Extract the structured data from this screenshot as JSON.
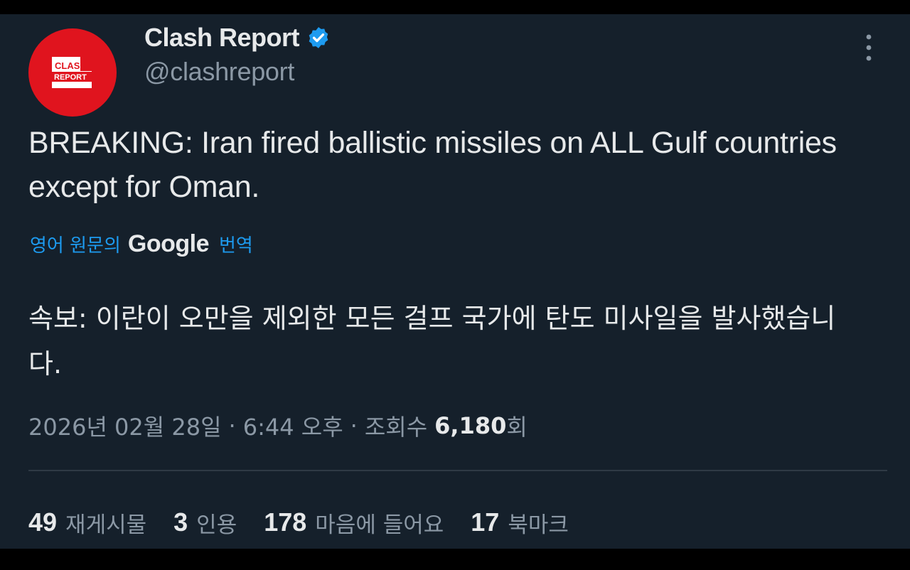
{
  "colors": {
    "background": "#15202b",
    "text_primary": "#e7e9ea",
    "text_secondary": "#8b98a5",
    "link": "#1d9bf0",
    "verified": "#1d9bf0",
    "avatar_red": "#e0141e"
  },
  "author": {
    "avatar_logo_line1": "CLASH",
    "avatar_logo_line2": "REPORT",
    "display_name": "Clash Report",
    "verified_icon": "verified-badge-icon",
    "handle": "@clashreport"
  },
  "menu": {
    "icon": "more-vertical-icon"
  },
  "tweet": {
    "text": "BREAKING: Iran fired ballistic missiles on ALL Gulf countries except for Oman."
  },
  "translation": {
    "prefix": "영어 원문의",
    "provider": "Google",
    "suffix": "번역",
    "text": "속보: 이란이 오만을 제외한 모든 걸프 국가에 탄도 미사일을 발사했습니다."
  },
  "meta": {
    "date": "2026년 02월 28일",
    "separator": "·",
    "time": "6:44 오후",
    "views_label": "조회수",
    "views_count": "6,180",
    "views_unit": "회"
  },
  "stats": [
    {
      "count": "49",
      "label": "재게시물"
    },
    {
      "count": "3",
      "label": "인용"
    },
    {
      "count": "178",
      "label": "마음에 들어요"
    },
    {
      "count": "17",
      "label": "북마크"
    }
  ]
}
